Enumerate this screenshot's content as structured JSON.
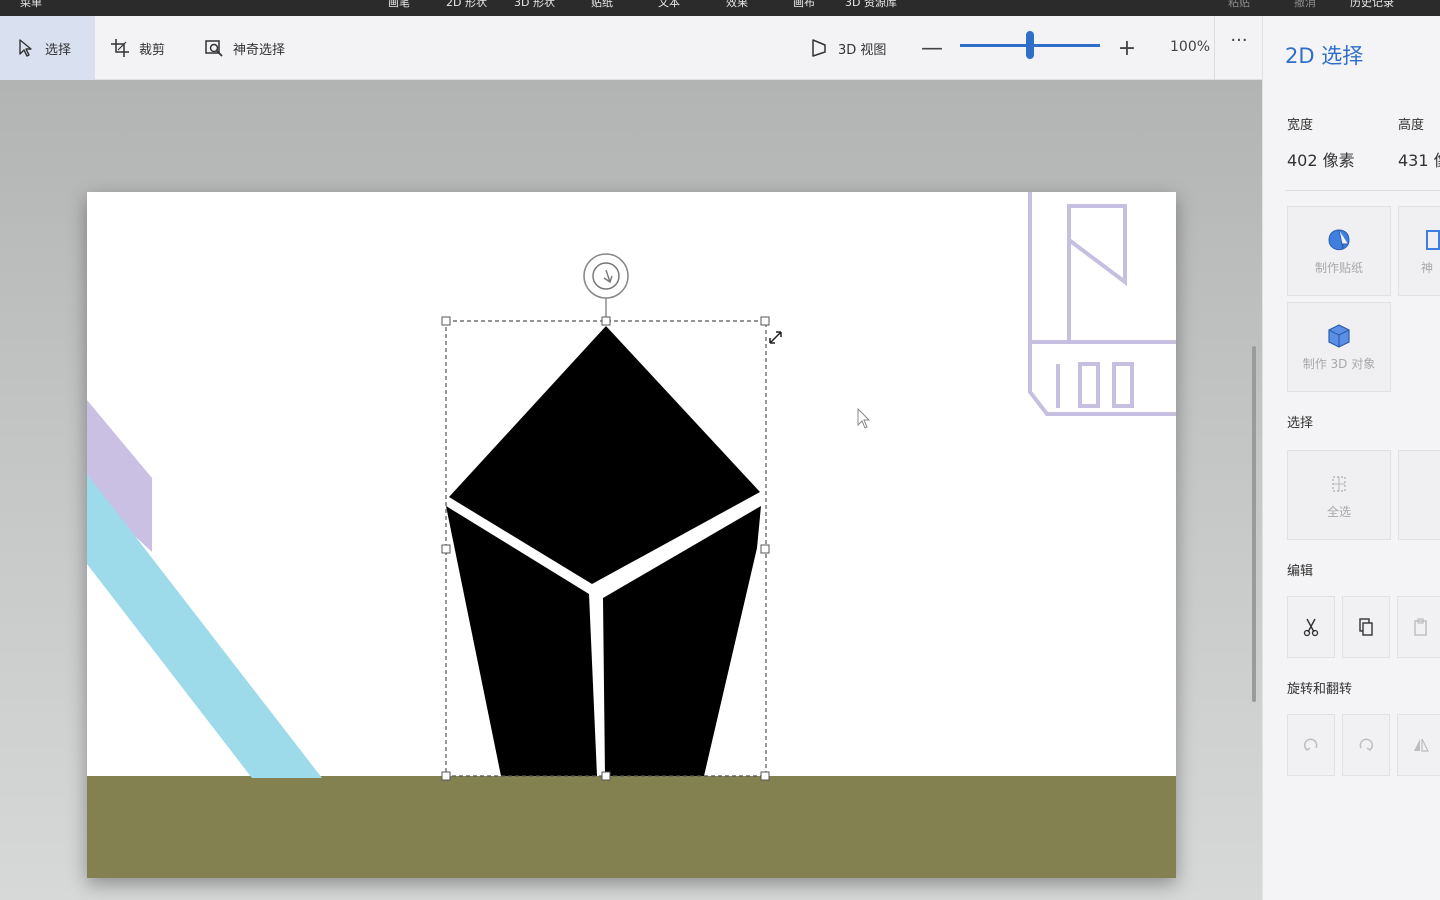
{
  "menu": {
    "app_name": "菜单",
    "tabs": [
      "画笔",
      "2D 形状",
      "3D 形状",
      "贴纸",
      "文本",
      "效果",
      "画布",
      "3D 资源库"
    ],
    "right_items": [
      "粘贴",
      "撤消",
      "历史记录"
    ]
  },
  "toolbar": {
    "select_label": "选择",
    "crop_label": "裁剪",
    "magic_select_label": "神奇选择",
    "view3d_label": "3D 视图",
    "zoom_minus": "—",
    "zoom_plus": "+",
    "zoom_value": "100%",
    "zoom_fraction": 0.5,
    "more_label": "···"
  },
  "panel": {
    "title": "2D 选择",
    "width_label": "宽度",
    "height_label": "高度",
    "width_value": "402 像素",
    "height_value": "431 像",
    "make_sticker": "制作贴纸",
    "magic_partial": "神",
    "make_3d": "制作 3D 对象",
    "select_section": "选择",
    "select_all": "全选",
    "edit_section": "编辑",
    "rotate_section": "旋转和翻转"
  },
  "icons": [
    "cursor-icon",
    "crop-icon",
    "magic-select-icon",
    "view-3d-icon",
    "minus-icon",
    "plus-icon",
    "more-icon",
    "sticker-icon",
    "cube-icon",
    "select-all-icon",
    "cut-icon",
    "copy-icon",
    "paste-icon",
    "rotate-left-icon",
    "rotate-right-icon",
    "flip-icon",
    "rotate-handle-icon"
  ],
  "colors": {
    "accent": "#2f6fc9",
    "canvas_bg": "#ffffff",
    "ground": "#848150",
    "lavender": "#c9c0e4",
    "sky_blue": "#9ddaea",
    "outline": "#c7bfe0",
    "shape": "#000000"
  }
}
